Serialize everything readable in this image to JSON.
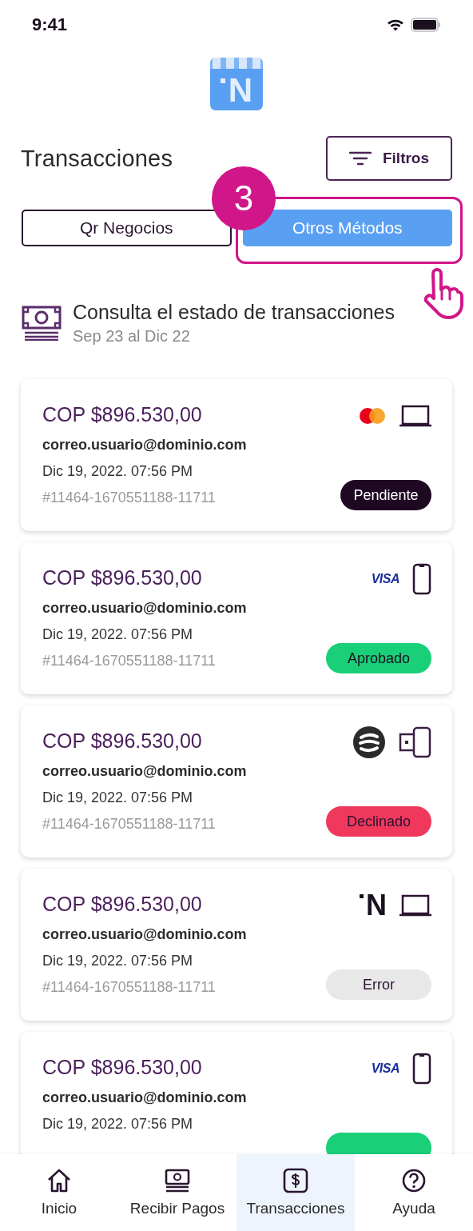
{
  "status_bar": {
    "time": "9:41"
  },
  "logo": {
    "letter": "N"
  },
  "header": {
    "title": "Transacciones",
    "filter_button": "Filtros"
  },
  "tabs": [
    {
      "label": "Qr Negocios",
      "selected": false
    },
    {
      "label": "Otros Métodos",
      "selected": true
    }
  ],
  "annotation": {
    "step": "3"
  },
  "summary": {
    "title": "Consulta el estado de transacciones",
    "period": "Sep 23 al Dic 22"
  },
  "transactions": [
    {
      "amount": "COP $896.530,00",
      "email": "correo.usuario@dominio.com",
      "date": "Dic 19, 2022. 07:56 PM",
      "reference": "#11464-1670551188-11711",
      "payment": {
        "kind": "mastercard"
      },
      "device": {
        "kind": "laptop"
      },
      "status": {
        "kind": "pending",
        "label": "Pendiente"
      }
    },
    {
      "amount": "COP $896.530,00",
      "email": "correo.usuario@dominio.com",
      "date": "Dic 19, 2022. 07:56 PM",
      "reference": "#11464-1670551188-11711",
      "payment": {
        "kind": "visa",
        "label": "VISA"
      },
      "device": {
        "kind": "phone"
      },
      "status": {
        "kind": "approved",
        "label": "Aprobado"
      }
    },
    {
      "amount": "COP $896.530,00",
      "email": "correo.usuario@dominio.com",
      "date": "Dic 19, 2022. 07:56 PM",
      "reference": "#11464-1670551188-11711",
      "payment": {
        "kind": "wallet"
      },
      "device": {
        "kind": "reader"
      },
      "status": {
        "kind": "declined",
        "label": "Declinado"
      }
    },
    {
      "amount": "COP $896.530,00",
      "email": "correo.usuario@dominio.com",
      "date": "Dic 19, 2022. 07:56 PM",
      "reference": "#11464-1670551188-11711",
      "payment": {
        "kind": "brand",
        "label": "N"
      },
      "device": {
        "kind": "laptop"
      },
      "status": {
        "kind": "error",
        "label": "Error"
      }
    },
    {
      "amount": "COP $896.530,00",
      "email": "correo.usuario@dominio.com",
      "date": "Dic 19, 2022. 07:56 PM",
      "payment": {
        "kind": "visa",
        "label": "VISA"
      },
      "device": {
        "kind": "phone"
      },
      "status": {
        "kind": "approved"
      }
    }
  ],
  "nav": [
    {
      "label": "Inicio",
      "selected": false
    },
    {
      "label": "Recibir Pagos",
      "selected": false
    },
    {
      "label": "Transacciones",
      "selected": true
    },
    {
      "label": "Ayuda",
      "selected": false
    }
  ]
}
